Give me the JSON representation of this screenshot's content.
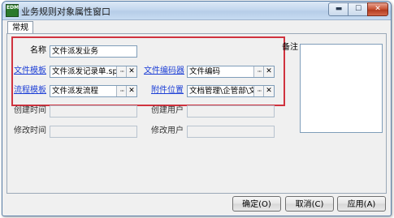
{
  "window": {
    "title": "业务规则对象属性窗口",
    "app_icon_text": "EDM",
    "minimize_glyph": "▬",
    "maximize_glyph": "☐",
    "close_glyph": "✕"
  },
  "tabs": [
    "常规"
  ],
  "form": {
    "name_label": "名称",
    "name_value": "文件派发业务",
    "file_template_label": "文件模板",
    "file_template_value": "文件派发记录单.sp",
    "file_encoder_label": "文件编码器",
    "file_encoder_value": "文件编码",
    "flow_template_label": "流程模板",
    "flow_template_value": "文件派发流程",
    "attachment_location_label": "附件位置",
    "attachment_location_value": "文档管理\\企管部\\文",
    "create_time_label": "创建时间",
    "create_time_value": "",
    "create_user_label": "创建用户",
    "create_user_value": "",
    "modify_time_label": "修改时间",
    "modify_time_value": "",
    "modify_user_label": "修改用户",
    "modify_user_value": "",
    "memo_label": "备注",
    "memo_value": ""
  },
  "picker": {
    "dots": "···",
    "clear": "✕"
  },
  "buttons": {
    "ok": "确定(O)",
    "cancel": "取消(C)",
    "apply": "应用(A)"
  },
  "colors": {
    "highlight_border": "#d0333f",
    "link": "#1d3fd6",
    "close_button": "#c75030"
  }
}
